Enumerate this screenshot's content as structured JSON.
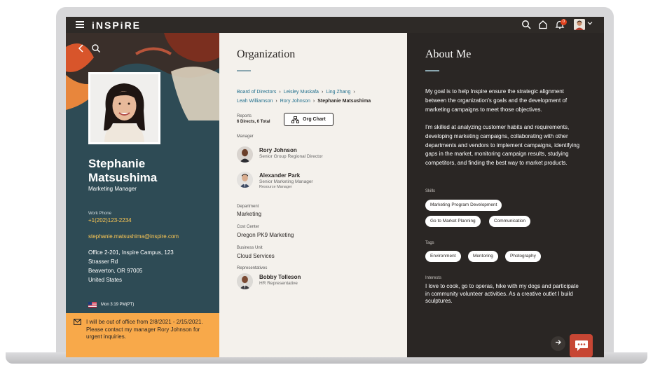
{
  "app": {
    "brand": "iNSPiRE",
    "notifications_count": "0"
  },
  "profile": {
    "name": "Stephanie Matsushima",
    "title": "Marketing Manager",
    "work_phone_label": "Work Phone",
    "work_phone": "+1(202)123-2234",
    "email": "stephanie.matsushima@inspire.com",
    "address_lines": [
      "Office 2-201, Inspire Campus, 123",
      "Strasser Rd",
      "Beaverton, OR 97005",
      "United States"
    ],
    "local_time": "Mon 3:19 PM(PT)",
    "out_of_office": "I will be out of office from 2/8/2021 - 2/15/2021. Please contact my manager Rory Johnson for urgent inquiries."
  },
  "organization": {
    "title": "Organization",
    "breadcrumb": [
      "Board of Directors",
      "Leisley Muskafa",
      "Ling Zhang",
      "Leah Williamson",
      "Rory Johnson",
      "Stephanie Matsushima"
    ],
    "reports_label": "Reports",
    "reports_value": "6 Directs, 6 Total",
    "org_chart_label": "Org Chart",
    "manager_label": "Manager",
    "managers": [
      {
        "name": "Rory Johnson",
        "title": "Senior Group Regional Director",
        "subtitle": ""
      },
      {
        "name": "Alexander Park",
        "title": "Senior Marketing Manager",
        "subtitle": "Resource Manager"
      }
    ],
    "department_label": "Department",
    "department": "Marketing",
    "cost_center_label": "Cost Center",
    "cost_center": "Oregon PK9 Marketing",
    "business_unit_label": "Business Unit",
    "business_unit": "Cloud Services",
    "representatives_label": "Representatives",
    "representatives": [
      {
        "name": "Bobby Tolleson",
        "title": "HR Representative"
      }
    ]
  },
  "about": {
    "title": "About Me",
    "paragraph1": "My goal is to help Inspire ensure the strategic alignment between the organization's goals and the development of marketing campaigns to meet those objectives.",
    "paragraph2": "I'm skilled at analyzing customer habits and requirements, developing marketing campaigns, collaborating with other departments and vendors to implement campaigns, identifying gaps in the market, monitoring campaign results, studying competitors, and finding the best way to market products.",
    "skills_label": "Skills",
    "skills": [
      "Marketing Program Development",
      "Go to Market Planning",
      "Communication"
    ],
    "tags_label": "Tags",
    "tags": [
      "Environment",
      "Mentoring",
      "Photography"
    ],
    "interests_label": "Interests",
    "interests": "I love to cook, go to operas, hike with my dogs and participate in community volunteer activities. As a creative outlet I build sculptures."
  },
  "colors": {
    "accent_orange": "#f8a94a",
    "link_blue": "#1f6e8c",
    "profile_panel": "#2e4b55",
    "chat_red": "#c74634"
  }
}
